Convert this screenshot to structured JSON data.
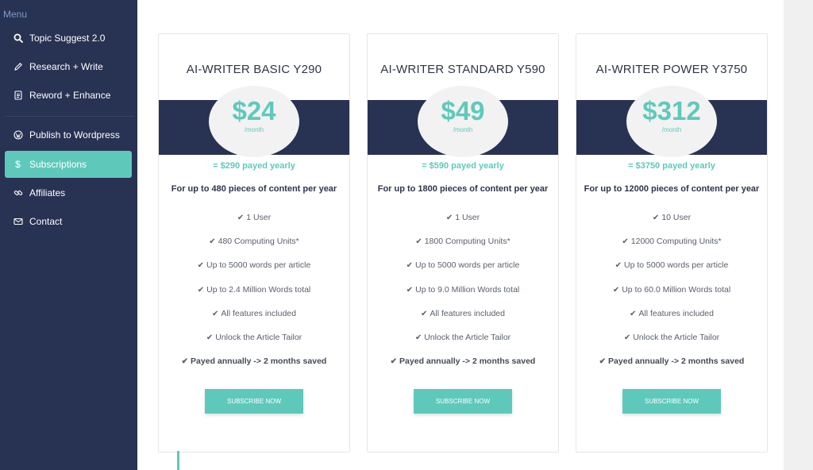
{
  "sidebar": {
    "menu_label": "Menu",
    "items": [
      {
        "label": "Topic Suggest 2.0",
        "icon": "search-icon"
      },
      {
        "label": "Research + Write",
        "icon": "pencil-icon"
      },
      {
        "label": "Reword + Enhance",
        "icon": "document-icon"
      },
      {
        "label": "Publish to Wordpress",
        "icon": "wordpress-icon"
      },
      {
        "label": "Subscriptions",
        "icon": "dollar-icon"
      },
      {
        "label": "Affiliates",
        "icon": "link-icon"
      },
      {
        "label": "Contact",
        "icon": "envelope-icon"
      }
    ],
    "active_item": "Subscriptions"
  },
  "plans": [
    {
      "title": "AI-WRITER BASIC Y290",
      "price": "$24",
      "period": "/month",
      "yearly": "= $290 payed yearly",
      "content": "For up to 480 pieces of content per year",
      "features": [
        "1 User",
        "480 Computing Units*",
        "Up to 5000 words per article",
        "Up to 2.4 Million Words total",
        "All features included",
        "Unlock the Article Tailor",
        "Payed annually -> 2 months saved"
      ],
      "button": "Subscribe Now"
    },
    {
      "title": "AI-WRITER STANDARD Y590",
      "price": "$49",
      "period": "/month",
      "yearly": "= $590 payed yearly",
      "content": "For up to 1800 pieces of content per year",
      "features": [
        "1 User",
        "1800 Computing Units*",
        "Up to 5000 words per article",
        "Up to 9.0 Million Words total",
        "All features included",
        "Unlock the Article Tailor",
        "Payed annually -> 2 months saved"
      ],
      "button": "Subscribe Now"
    },
    {
      "title": "AI-WRITER POWER Y3750",
      "price": "$312",
      "period": "/month",
      "yearly": "= $3750 payed yearly",
      "content": "For up to 12000 pieces of content per year",
      "features": [
        "10 User",
        "12000 Computing Units*",
        "Up to 5000 words per article",
        "Up to 60.0 Million Words total",
        "All features included",
        "Unlock the Article Tailor",
        "Payed annually -> 2 months saved"
      ],
      "button": "Subscribe Now"
    }
  ],
  "colors": {
    "sidebar_bg": "#283252",
    "accent": "#5ec9bb",
    "band": "#283252"
  }
}
